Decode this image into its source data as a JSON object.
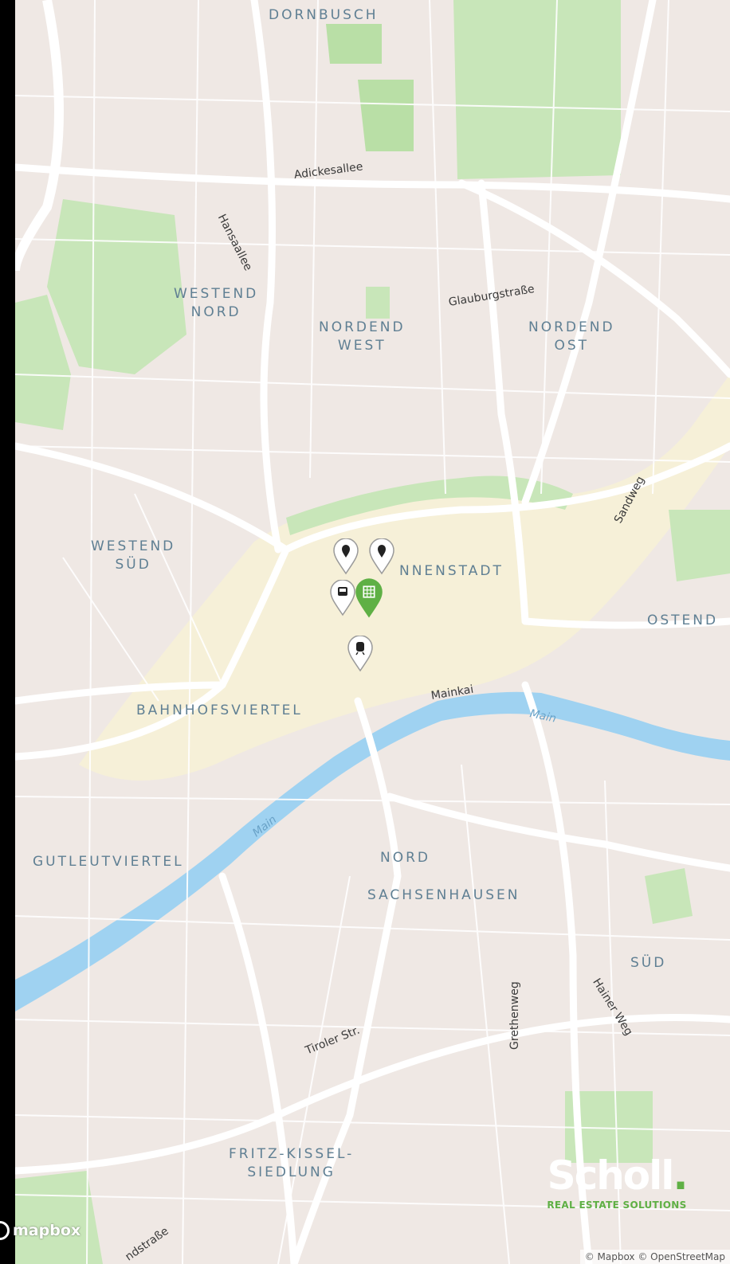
{
  "map": {
    "districts": [
      {
        "id": "dornbusch",
        "text": "DORNBUSCH"
      },
      {
        "id": "westend-nord",
        "text": "WESTEND\nNORD"
      },
      {
        "id": "nordend-west",
        "text": "NORDEND\nWEST"
      },
      {
        "id": "nordend-ost",
        "text": "NORDEND\nOST"
      },
      {
        "id": "westend-sued",
        "text": "WESTEND\nSÜD"
      },
      {
        "id": "innenstadt",
        "text": "NNENSTADT"
      },
      {
        "id": "ostend",
        "text": "OSTEND"
      },
      {
        "id": "bahnhofsviertel",
        "text": "BAHNHOFSVIERTEL"
      },
      {
        "id": "gutleutviertel",
        "text": "GUTLEUTVIERTEL"
      },
      {
        "id": "nord",
        "text": "NORD"
      },
      {
        "id": "sachsenhausen",
        "text": "SACHSENHAUSEN"
      },
      {
        "id": "sued",
        "text": "SÜD"
      },
      {
        "id": "fritz-kissel",
        "text": "FRITZ-KISSEL-\nSIEDLUNG"
      }
    ],
    "streets": [
      {
        "id": "adickesallee",
        "text": "Adickesallee"
      },
      {
        "id": "hansaallee",
        "text": "Hansaallee"
      },
      {
        "id": "glauburgstrasse",
        "text": "Glauburgstraße"
      },
      {
        "id": "sandweg",
        "text": "Sandweg"
      },
      {
        "id": "mainkai",
        "text": "Mainkai"
      },
      {
        "id": "tiroler",
        "text": "Tiroler Str."
      },
      {
        "id": "grethenweg",
        "text": "Grethenweg"
      },
      {
        "id": "hainer-weg",
        "text": "Hainer Weg"
      },
      {
        "id": "landstrasse",
        "text": "ndstraße"
      }
    ],
    "water_labels": [
      {
        "id": "main-east",
        "text": "Main"
      },
      {
        "id": "main-west",
        "text": "Main"
      }
    ],
    "markers": [
      {
        "id": "property",
        "icon": "building-icon",
        "color": "#5fb045"
      },
      {
        "id": "poi-1",
        "icon": "location-pin-icon",
        "color": "#ffffff"
      },
      {
        "id": "poi-2",
        "icon": "location-pin-icon",
        "color": "#ffffff"
      },
      {
        "id": "poi-3",
        "icon": "bus-icon",
        "color": "#ffffff"
      },
      {
        "id": "poi-4",
        "icon": "train-icon",
        "color": "#ffffff"
      }
    ],
    "colors": {
      "land": "#efe8e4",
      "park": "#c8e6b9",
      "water": "#9fd2f1",
      "road": "#ffffff",
      "center": "#f6f0d8",
      "district_label": "#5f7f93"
    }
  },
  "branding": {
    "name": "Scholl",
    "dot": ".",
    "tagline": "REAL ESTATE SOLUTIONS"
  },
  "footer": {
    "mapbox": "mapbox",
    "attribution": "© Mapbox © OpenStreetMap"
  }
}
